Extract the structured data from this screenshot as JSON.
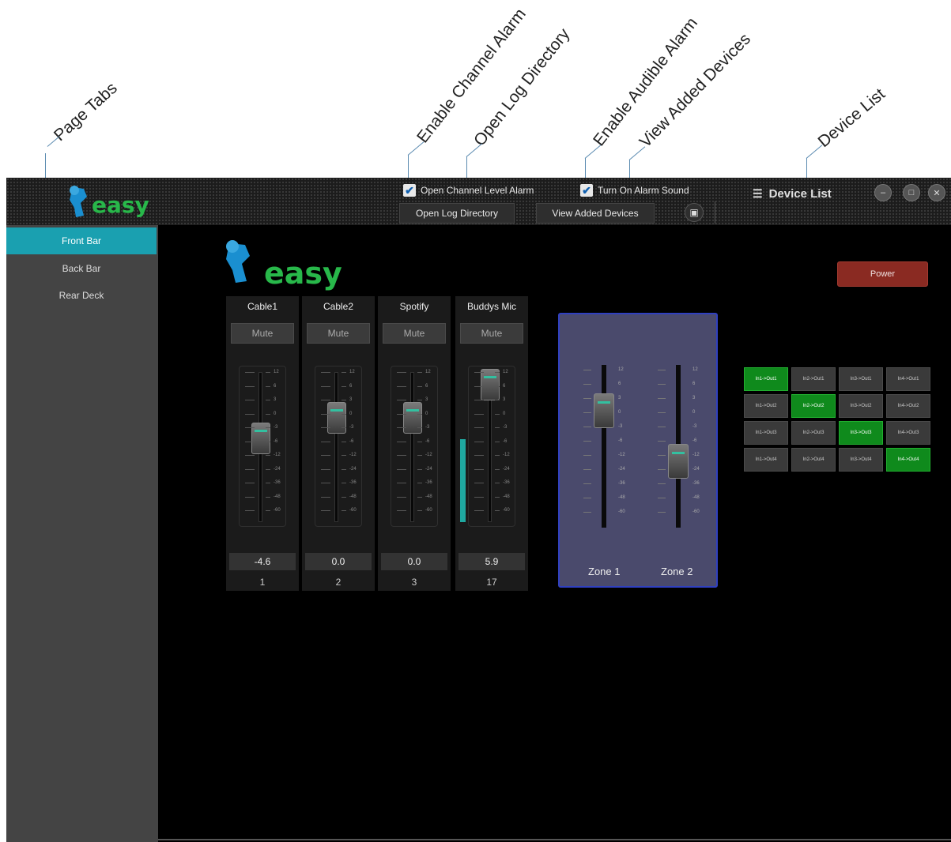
{
  "annotations": [
    "Page Tabs",
    "Enable Channel Alarm",
    "Open Log Directory",
    "Enable Audible Alarm",
    "View Added Devices",
    "Device List"
  ],
  "titlebar": {
    "logo_text": "easy",
    "channel_alarm_label": "Open Channel Level Alarm",
    "channel_alarm_checked": true,
    "alarm_sound_label": "Turn On Alarm Sound",
    "alarm_sound_checked": true,
    "open_log_label": "Open Log Directory",
    "view_devices_label": "View Added Devices",
    "device_list_label": "Device List"
  },
  "tabs": [
    {
      "label": "Front Bar",
      "active": true
    },
    {
      "label": "Back Bar",
      "active": false
    },
    {
      "label": "Rear Deck",
      "active": false
    }
  ],
  "main": {
    "logo_text": "easy",
    "power_label": "Power",
    "mute_label": "Mute",
    "scale": [
      "12",
      "6",
      "3",
      "0",
      "-3",
      "-6",
      "-12",
      "-24",
      "-36",
      "-48",
      "-60"
    ],
    "channels": [
      {
        "name": "Cable1",
        "value": "-4.6",
        "number": "1",
        "meter": 0
      },
      {
        "name": "Cable2",
        "value": "0.0",
        "number": "2",
        "meter": 0
      },
      {
        "name": "Spotify",
        "value": "0.0",
        "number": "3",
        "meter": 0
      },
      {
        "name": "Buddys Mic",
        "value": "5.9",
        "number": "17",
        "meter": 0.55
      }
    ],
    "zones": [
      {
        "name": "Zone 1"
      },
      {
        "name": "Zone 2"
      }
    ],
    "matrix": [
      [
        {
          "label": "In1->Out1",
          "on": true
        },
        {
          "label": "In2->Out1",
          "on": false
        },
        {
          "label": "In3->Out1",
          "on": false
        },
        {
          "label": "In4->Out1",
          "on": false
        }
      ],
      [
        {
          "label": "In1->Out2",
          "on": false
        },
        {
          "label": "In2->Out2",
          "on": true
        },
        {
          "label": "In3->Out2",
          "on": false
        },
        {
          "label": "In4->Out2",
          "on": false
        }
      ],
      [
        {
          "label": "In1->Out3",
          "on": false
        },
        {
          "label": "In2->Out3",
          "on": false
        },
        {
          "label": "In3->Out3",
          "on": true
        },
        {
          "label": "In4->Out3",
          "on": false
        }
      ],
      [
        {
          "label": "In1->Out4",
          "on": false
        },
        {
          "label": "In2->Out4",
          "on": false
        },
        {
          "label": "In3->Out4",
          "on": false
        },
        {
          "label": "In4->Out4",
          "on": true
        }
      ]
    ]
  },
  "colors": {
    "accent_teal": "#1aa0b0",
    "logo_green": "#28b84a",
    "matrix_on": "#0f8a1c",
    "power_red": "#8a2a22",
    "zone_border": "#3040c0"
  }
}
